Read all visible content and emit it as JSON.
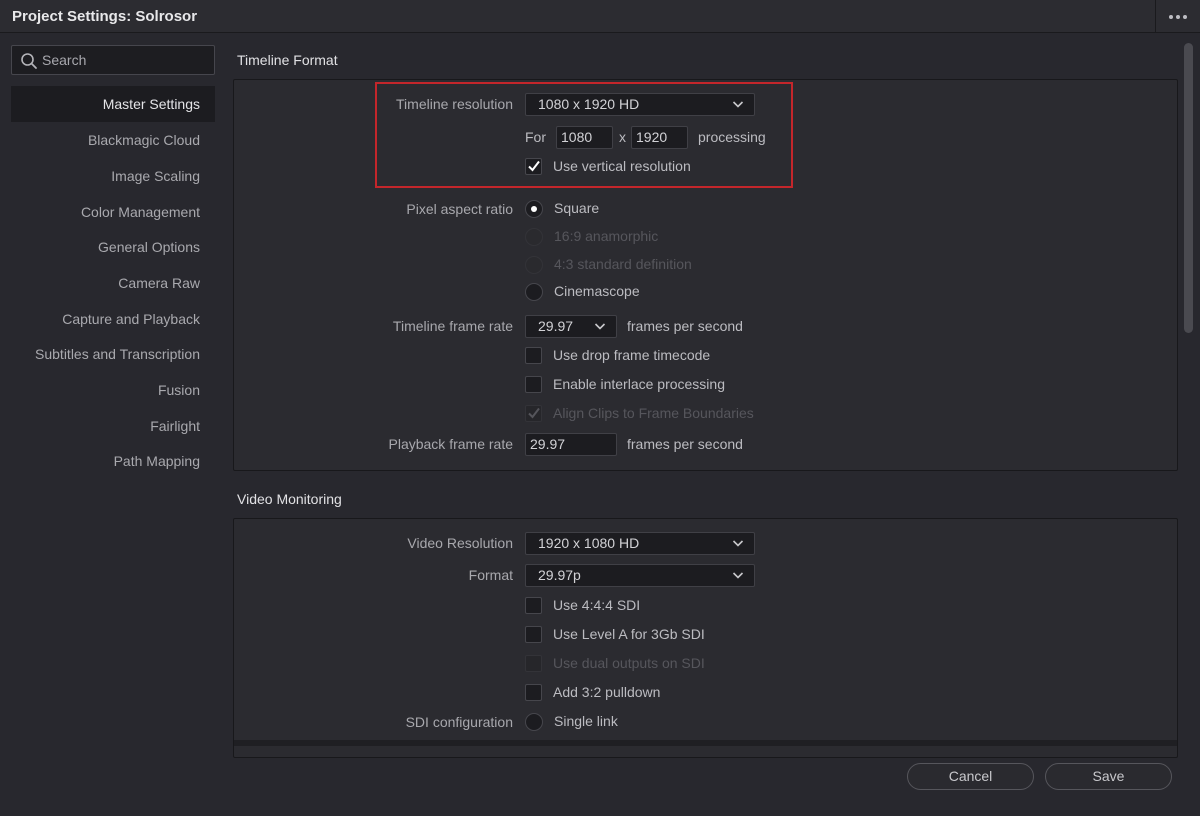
{
  "window": {
    "title": "Project Settings: Solrosor"
  },
  "search": {
    "placeholder": "Search"
  },
  "sidebar": {
    "items": [
      {
        "label": "Master Settings",
        "active": true
      },
      {
        "label": "Blackmagic Cloud"
      },
      {
        "label": "Image Scaling"
      },
      {
        "label": "Color Management"
      },
      {
        "label": "General Options"
      },
      {
        "label": "Camera Raw"
      },
      {
        "label": "Capture and Playback"
      },
      {
        "label": "Subtitles and Transcription"
      },
      {
        "label": "Fusion"
      },
      {
        "label": "Fairlight"
      },
      {
        "label": "Path Mapping"
      }
    ]
  },
  "timeline_format": {
    "title": "Timeline Format",
    "resolution_label": "Timeline resolution",
    "resolution_value": "1080 x 1920 HD",
    "for_label": "For",
    "width_value": "1080",
    "x_label": "x",
    "height_value": "1920",
    "processing_label": "processing",
    "vertical_label": "Use vertical resolution",
    "vertical_checked": true,
    "par_label": "Pixel aspect ratio",
    "par_options": [
      {
        "label": "Square",
        "selected": true,
        "disabled": false
      },
      {
        "label": "16:9 anamorphic",
        "selected": false,
        "disabled": true
      },
      {
        "label": "4:3 standard definition",
        "selected": false,
        "disabled": true
      },
      {
        "label": "Cinemascope",
        "selected": false,
        "disabled": false
      }
    ],
    "frame_rate_label": "Timeline frame rate",
    "frame_rate_value": "29.97",
    "fps_label": "frames per second",
    "drop_frame_label": "Use drop frame timecode",
    "interlace_label": "Enable interlace processing",
    "align_label": "Align Clips to Frame Boundaries",
    "playback_label": "Playback frame rate",
    "playback_value": "29.97",
    "playback_fps_label": "frames per second"
  },
  "video_monitoring": {
    "title": "Video Monitoring",
    "resolution_label": "Video Resolution",
    "resolution_value": "1920 x 1080 HD",
    "format_label": "Format",
    "format_value": "29.97p",
    "sdi444_label": "Use 4:4:4 SDI",
    "levela_label": "Use Level A for 3Gb SDI",
    "dual_label": "Use dual outputs on SDI",
    "pulldown_label": "Add 3:2 pulldown",
    "sdi_config_label": "SDI configuration",
    "sdi_options": [
      {
        "label": "Single link"
      }
    ]
  },
  "footer": {
    "cancel_label": "Cancel",
    "save_label": "Save"
  }
}
